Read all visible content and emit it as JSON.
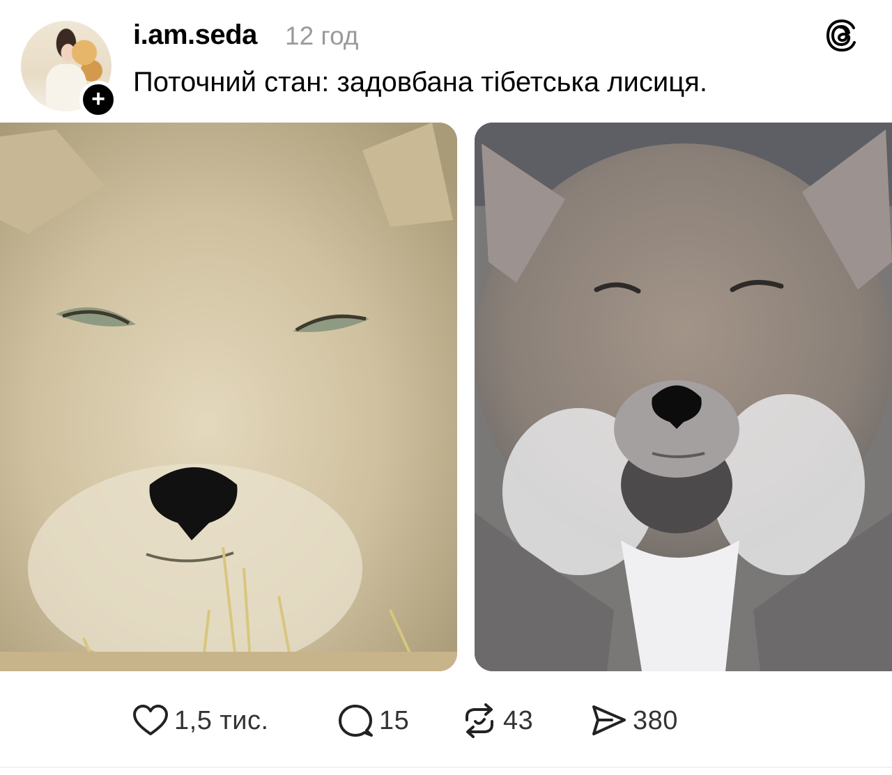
{
  "post": {
    "username": "i.am.seda",
    "timestamp": "12 год",
    "caption": "Поточний стан: задовбана тібетська лисиця.",
    "follow_symbol": "+"
  },
  "images": [
    {
      "name": "fox-photo-left",
      "tone": "#cdbf9d"
    },
    {
      "name": "fox-photo-right",
      "tone": "#8d8682"
    }
  ],
  "actions": {
    "likes": "1,5 тис.",
    "replies": "15",
    "reposts": "43",
    "shares": "380"
  },
  "icons": {
    "app": "threads-icon",
    "like": "heart-icon",
    "reply": "reply-bubble-icon",
    "repost": "repost-icon",
    "share": "send-icon"
  },
  "colors": {
    "text": "#000000",
    "muted": "#9a9a9a",
    "count": "#333333"
  }
}
